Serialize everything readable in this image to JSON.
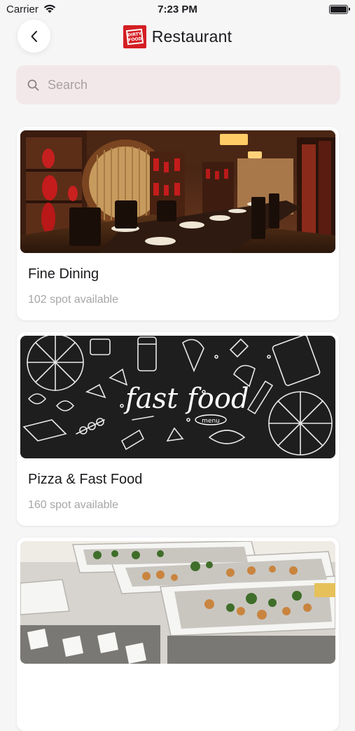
{
  "status_bar": {
    "carrier": "Carrier",
    "time": "7:23 PM"
  },
  "header": {
    "title": "Restaurant",
    "logo_text_line1": "DIRTY",
    "logo_text_line2": "FOOD"
  },
  "search": {
    "placeholder": "Search"
  },
  "colors": {
    "accent": "#d41f24",
    "search_bg": "#f3e8e9",
    "subtext": "#a7a5a8"
  },
  "categories": [
    {
      "title": "Fine Dining",
      "availability": "102 spot available",
      "image": "restaurant-interior"
    },
    {
      "title": "Pizza & Fast Food",
      "availability": "160 spot available",
      "image": "fast-food-doodle",
      "image_text": "fast food",
      "image_subtext": "menu"
    },
    {
      "title": "",
      "availability": "",
      "image": "buffet-trays"
    }
  ]
}
